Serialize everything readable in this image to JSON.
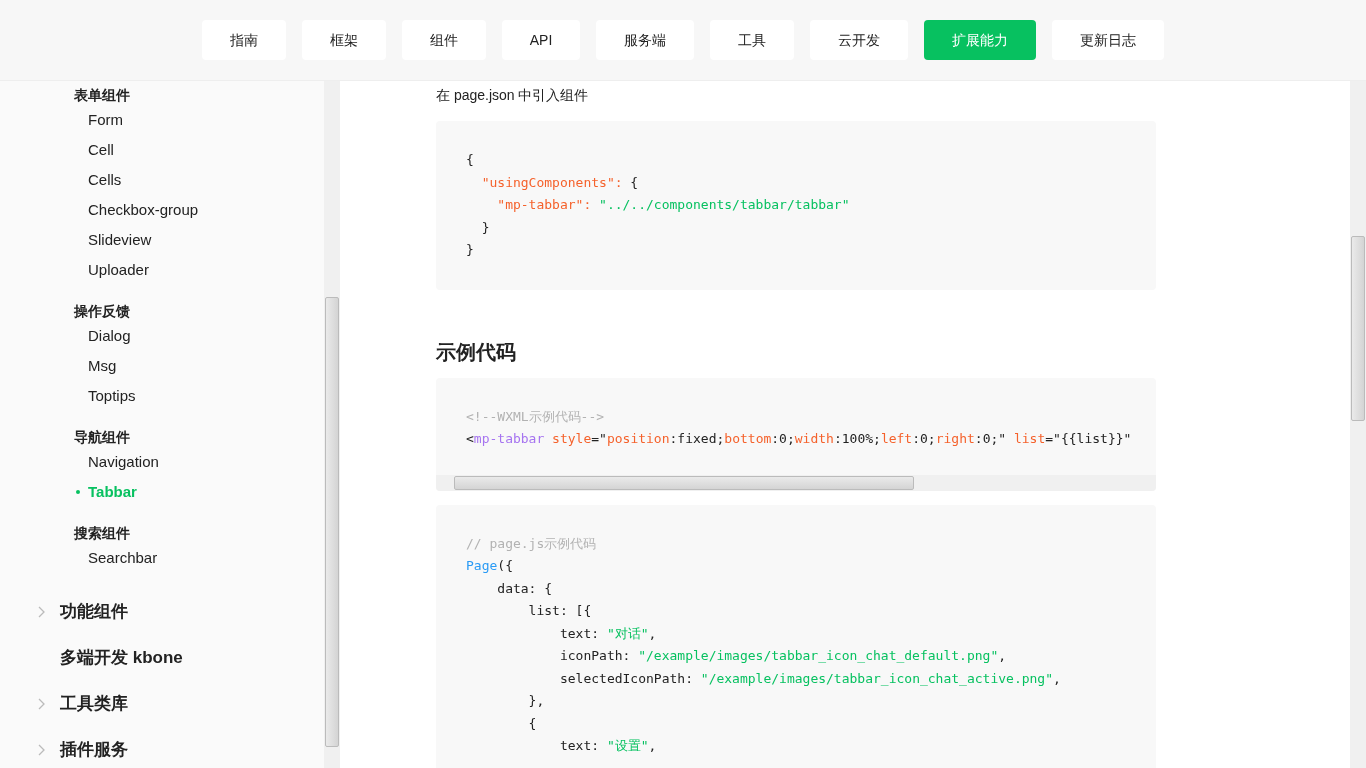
{
  "nav": [
    {
      "label": "指南",
      "selected": false
    },
    {
      "label": "框架",
      "selected": false
    },
    {
      "label": "组件",
      "selected": false
    },
    {
      "label": "API",
      "selected": false
    },
    {
      "label": "服务端",
      "selected": false
    },
    {
      "label": "工具",
      "selected": false
    },
    {
      "label": "云开发",
      "selected": false
    },
    {
      "label": "扩展能力",
      "selected": true
    },
    {
      "label": "更新日志",
      "selected": false
    }
  ],
  "sidebar": {
    "groups": [
      {
        "title": "表单组件",
        "items": [
          {
            "label": "Form",
            "selected": false
          },
          {
            "label": "Cell",
            "selected": false
          },
          {
            "label": "Cells",
            "selected": false
          },
          {
            "label": "Checkbox-group",
            "selected": false
          },
          {
            "label": "Slideview",
            "selected": false
          },
          {
            "label": "Uploader",
            "selected": false
          }
        ]
      },
      {
        "title": "操作反馈",
        "items": [
          {
            "label": "Dialog",
            "selected": false
          },
          {
            "label": "Msg",
            "selected": false
          },
          {
            "label": "Toptips",
            "selected": false
          }
        ]
      },
      {
        "title": "导航组件",
        "items": [
          {
            "label": "Navigation",
            "selected": false
          },
          {
            "label": "Tabbar",
            "selected": true
          }
        ]
      },
      {
        "title": "搜索组件",
        "items": [
          {
            "label": "Searchbar",
            "selected": false
          }
        ]
      }
    ],
    "sections": [
      {
        "label": "功能组件",
        "expandable": true
      },
      {
        "label": "多端开发 kbone",
        "expandable": false
      },
      {
        "label": "工具类库",
        "expandable": true
      },
      {
        "label": "插件服务",
        "expandable": true
      }
    ]
  },
  "content": [
    {
      "kind": "text",
      "text": "在 page.json 中引入组件"
    },
    {
      "kind": "code",
      "lines": [
        [
          {
            "kind": "plain",
            "text": "{"
          }
        ],
        [
          {
            "kind": "key",
            "text": "  \"usingComponents\":"
          },
          {
            "kind": "plain",
            "text": " {"
          }
        ],
        [
          {
            "kind": "key",
            "text": "    \"mp-tabbar\":"
          },
          {
            "kind": "string",
            "text": " \"../../components/tabbar/tabbar\""
          }
        ],
        [
          {
            "kind": "plain",
            "text": "  }"
          }
        ],
        [
          {
            "kind": "plain",
            "text": "}"
          }
        ]
      ]
    },
    {
      "kind": "heading",
      "text": "示例代码"
    },
    {
      "kind": "code-wide",
      "lines": [
        [
          {
            "kind": "comment",
            "text": "<!--WXML示例代码-->"
          }
        ],
        [
          {
            "kind": "plain",
            "text": "<"
          },
          {
            "kind": "tag",
            "text": "mp-tabbar"
          },
          {
            "kind": "key",
            "text": " style"
          },
          {
            "kind": "plain",
            "text": "=\""
          },
          {
            "kind": "key",
            "text": "position"
          },
          {
            "kind": "plain",
            "text": ":fixed;"
          },
          {
            "kind": "key",
            "text": "bottom"
          },
          {
            "kind": "plain",
            "text": ":0;"
          },
          {
            "kind": "key",
            "text": "width"
          },
          {
            "kind": "plain",
            "text": ":100%;"
          },
          {
            "kind": "key",
            "text": "left"
          },
          {
            "kind": "plain",
            "text": ":0;"
          },
          {
            "kind": "key",
            "text": "right"
          },
          {
            "kind": "plain",
            "text": ":0;\" "
          },
          {
            "kind": "key",
            "text": "list"
          },
          {
            "kind": "plain",
            "text": "=\"{{list}}\""
          }
        ]
      ]
    },
    {
      "kind": "code",
      "lines": [
        [
          {
            "kind": "comment",
            "text": "// page.js示例代码"
          }
        ],
        [
          {
            "kind": "func",
            "text": "Page"
          },
          {
            "kind": "plain",
            "text": "({"
          }
        ],
        [
          {
            "kind": "plain",
            "text": "    data: {"
          }
        ],
        [
          {
            "kind": "plain",
            "text": "        list: [{"
          }
        ],
        [
          {
            "kind": "plain",
            "text": "            text: "
          },
          {
            "kind": "string",
            "text": "\"对话\""
          },
          {
            "kind": "plain",
            "text": ","
          }
        ],
        [
          {
            "kind": "plain",
            "text": "            iconPath: "
          },
          {
            "kind": "string",
            "text": "\"/example/images/tabbar_icon_chat_default.png\""
          },
          {
            "kind": "plain",
            "text": ","
          }
        ],
        [
          {
            "kind": "plain",
            "text": "            selectedIconPath: "
          },
          {
            "kind": "string",
            "text": "\"/example/images/tabbar_icon_chat_active.png\""
          },
          {
            "kind": "plain",
            "text": ","
          }
        ],
        [
          {
            "kind": "plain",
            "text": "        },"
          }
        ],
        [
          {
            "kind": "plain",
            "text": "        {"
          }
        ],
        [
          {
            "kind": "plain",
            "text": "            text: "
          },
          {
            "kind": "string",
            "text": "\"设置\""
          },
          {
            "kind": "plain",
            "text": ","
          }
        ]
      ]
    }
  ]
}
